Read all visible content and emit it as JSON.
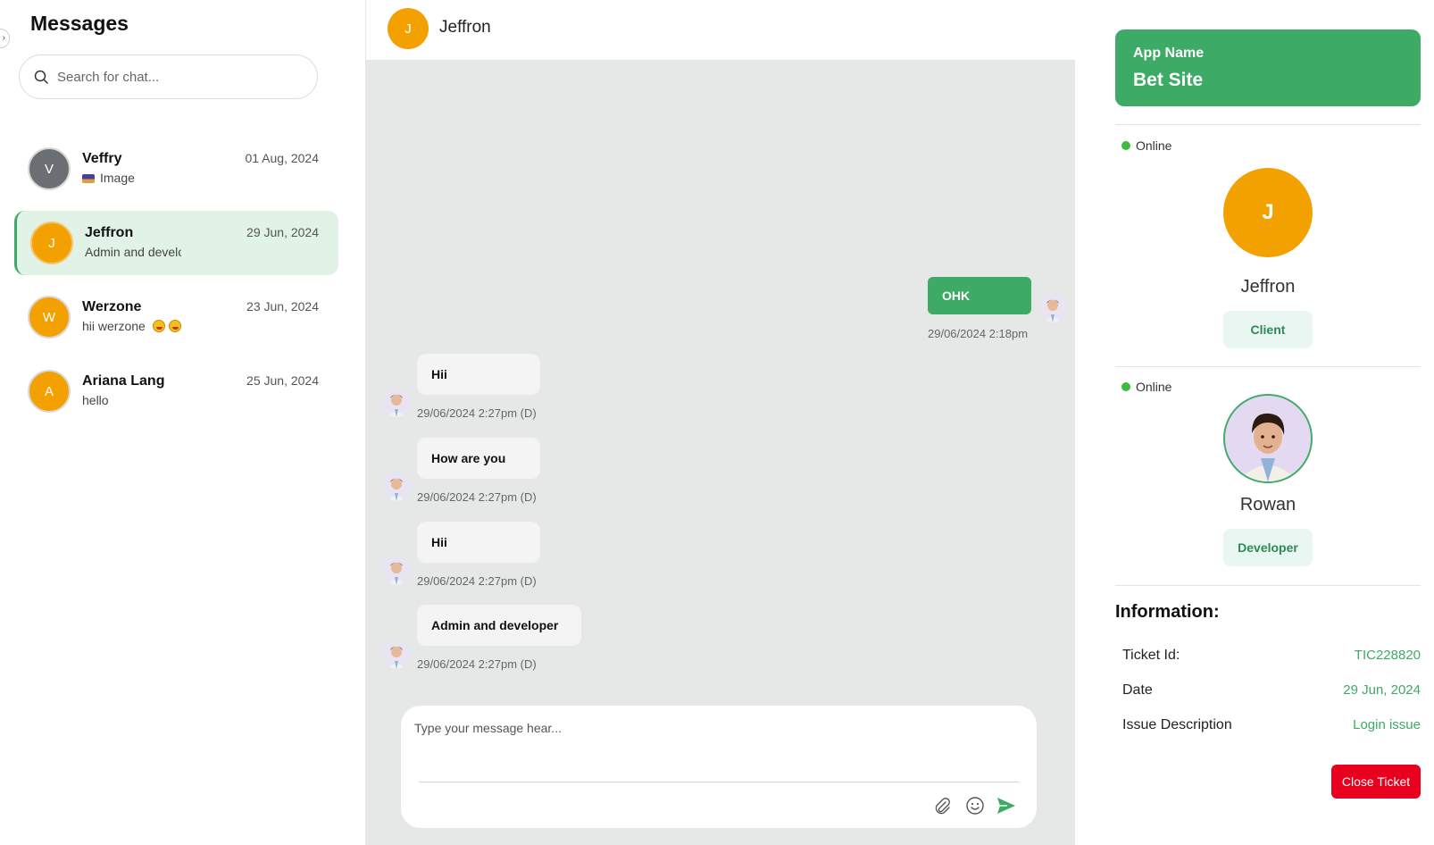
{
  "sidebar": {
    "title": "Messages",
    "search_placeholder": "Search for chat...",
    "chats": [
      {
        "initial": "V",
        "name": "Veffry",
        "preview": "Image",
        "date": "01 Aug, 2024",
        "color": "#6b6f73",
        "active": false
      },
      {
        "initial": "J",
        "name": "Jeffron",
        "preview": "Admin and developer",
        "date": "29 Jun, 2024",
        "color": "#f2a100",
        "active": true
      },
      {
        "initial": "W",
        "name": "Werzone",
        "preview": "hii werzone",
        "date": "23 Jun, 2024",
        "color": "#f2a100",
        "active": false
      },
      {
        "initial": "A",
        "name": "Ariana Lang",
        "preview": "hello",
        "date": "25 Jun, 2024",
        "color": "#f2a100",
        "active": false
      }
    ]
  },
  "chat": {
    "header_initial": "J",
    "header_name": "Jeffron",
    "messages": [
      {
        "direction": "out",
        "text": "OHK",
        "time": "29/06/2024 2:18pm"
      },
      {
        "direction": "in",
        "text": "Hii",
        "time": "29/06/2024 2:27pm (D)"
      },
      {
        "direction": "in",
        "text": "How are you",
        "time": "29/06/2024 2:27pm (D)"
      },
      {
        "direction": "in",
        "text": "Hii",
        "time": "29/06/2024 2:27pm (D)"
      },
      {
        "direction": "in",
        "text": "Admin and developer",
        "time": "29/06/2024 2:27pm (D)"
      }
    ],
    "composer_placeholder": "Type your message hear..."
  },
  "panel": {
    "app_label": "App Name",
    "app_value": "Bet Site",
    "client": {
      "status": "Online",
      "initial": "J",
      "name": "Jeffron",
      "role": "Client"
    },
    "developer": {
      "status": "Online",
      "name": "Rowan",
      "role": "Developer"
    },
    "info_title": "Information:",
    "info": [
      {
        "key": "Ticket Id:",
        "value": "TIC228820"
      },
      {
        "key": "Date",
        "value": "29 Jun, 2024"
      },
      {
        "key": "Issue Description",
        "value": "Login issue"
      }
    ],
    "close_label": "Close Ticket"
  },
  "colors": {
    "accent": "#3daa66",
    "avatar": "#f2a100",
    "danger": "#e8001e",
    "chat_bg": "#e5e8e7"
  }
}
